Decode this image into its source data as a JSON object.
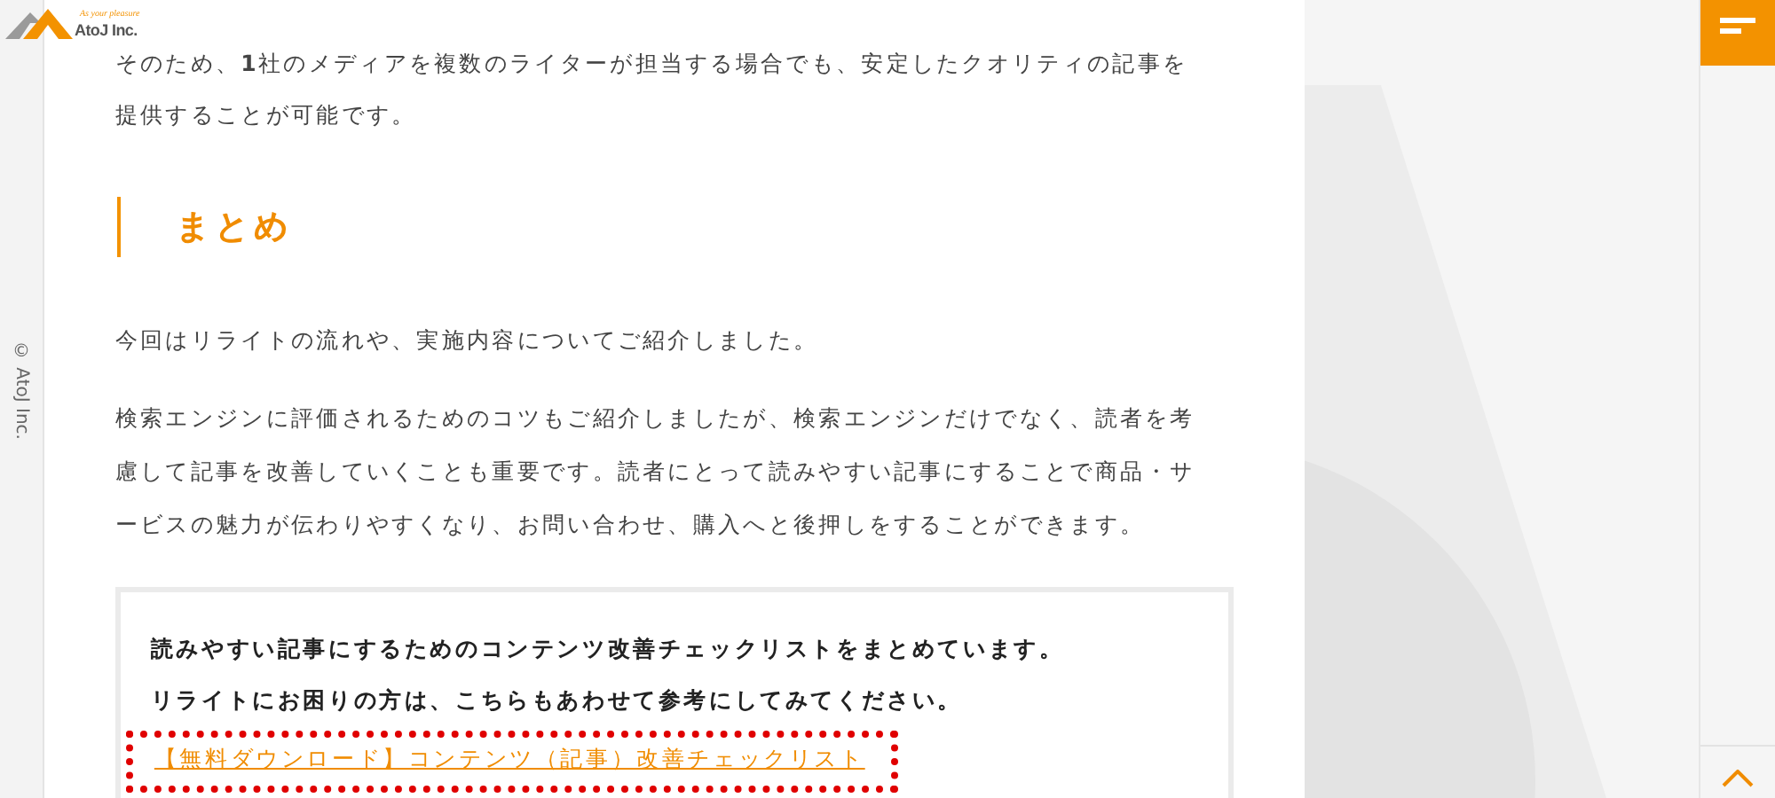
{
  "logo": {
    "tagline": "As your pleasure",
    "name": "AtoJ Inc."
  },
  "sidebar": {
    "copyright": "© AtoJ Inc."
  },
  "article": {
    "intro": [
      "そのため、**1**社のメディアを複数のライターが担当する場合でも、安定したクオリティの記事を提供することが可能です。"
    ],
    "heading": "まとめ",
    "paragraphs": [
      "今回はリライトの流れや、実施内容についてご紹介しました。",
      "検索エンジンに評価されるためのコツもご紹介しましたが、検索エンジンだけでなく、読者を考慮して記事を改善していくことも重要です。読者にとって読みやすい記事にすることで商品・サービスの魅力が伝わりやすくなり、お問い合わせ、購入へと後押しをすることができます。"
    ],
    "callout": {
      "lines": [
        "読みやすい記事にするためのコンテンツ改善チェックリストをまとめています。",
        "リライトにお困りの方は、こちらもあわせて参考にしてみてください。"
      ],
      "link": {
        "text": "【無料ダウンロード】コンテンツ（記事）改善チェックリスト",
        "highlighted": true
      }
    }
  }
}
